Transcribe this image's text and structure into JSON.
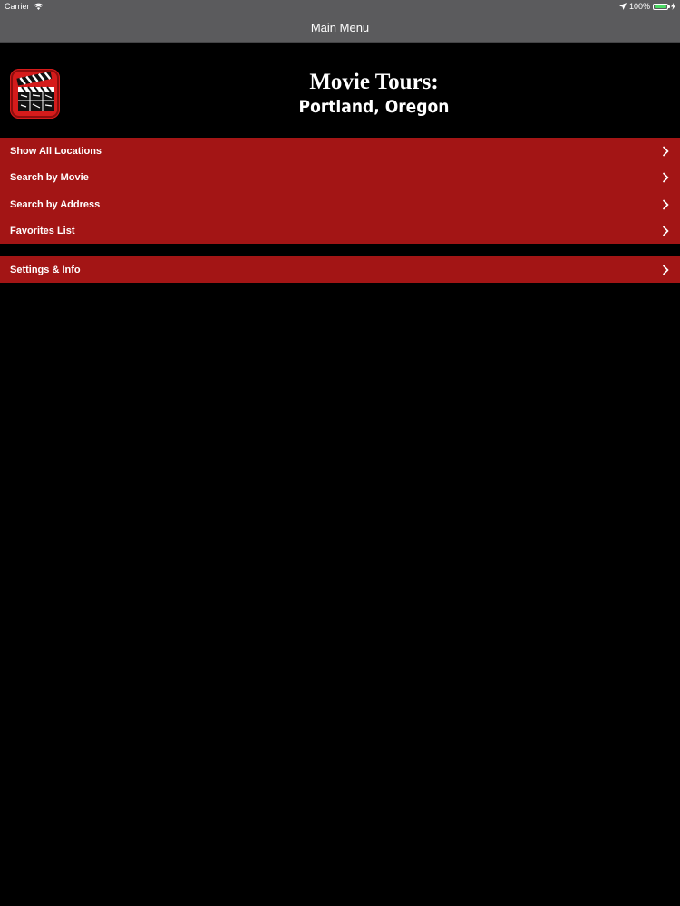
{
  "status_bar": {
    "carrier": "Carrier",
    "battery_percent": "100%",
    "battery_level": 1.0,
    "icons": [
      "wifi-icon",
      "location-arrow-icon",
      "battery-icon",
      "charging-bolt-icon"
    ]
  },
  "nav": {
    "title": "Main Menu"
  },
  "header": {
    "title": "Movie Tours:",
    "subtitle": "Portland, Oregon",
    "icon": "clapperboard-icon"
  },
  "menu": {
    "items": [
      {
        "label": "Show All Locations"
      },
      {
        "label": "Search by Movie"
      },
      {
        "label": "Search by Address"
      },
      {
        "label": "Favorites List"
      }
    ]
  },
  "settings_menu": {
    "items": [
      {
        "label": "Settings & Info"
      }
    ]
  },
  "colors": {
    "background": "#000000",
    "nav_bar": "#5b5b5d",
    "menu_row": "#a31515",
    "text": "#ffffff",
    "battery_fill": "#4cd964"
  }
}
